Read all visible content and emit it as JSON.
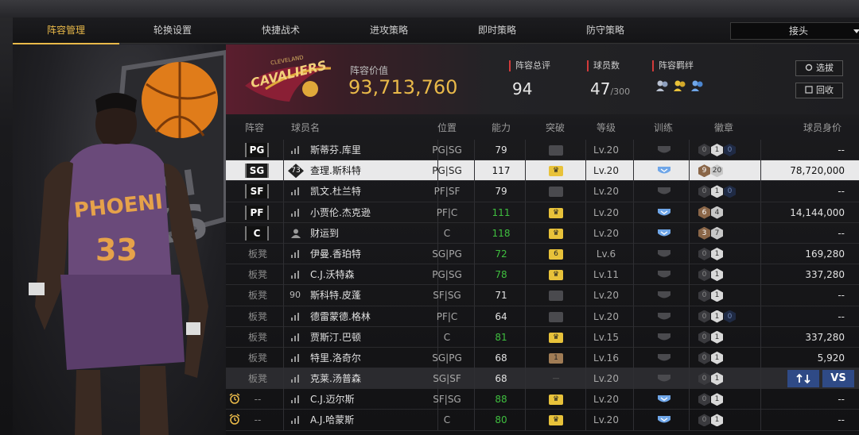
{
  "tabs": [
    {
      "label": "阵容管理",
      "active": true
    },
    {
      "label": "轮换设置",
      "active": false
    },
    {
      "label": "快捷战术",
      "active": false
    },
    {
      "label": "进攻策略",
      "active": false
    },
    {
      "label": "即时策略",
      "active": false
    },
    {
      "label": "防守策略",
      "active": false
    }
  ],
  "dropdown": {
    "value": "接头"
  },
  "team": {
    "logo_text": "CAVALIERS",
    "logo_sub": "CLEVELAND",
    "value_label": "阵容价值",
    "value": "93,713,760"
  },
  "stats": {
    "rating_label": "阵容总评",
    "rating": "94",
    "players_label": "球员数",
    "players": "47",
    "players_max": "/300",
    "bond_label": "阵容羁绊"
  },
  "buttons": {
    "select": "选拔",
    "recycle": "回收"
  },
  "columns": {
    "lineup": "阵容",
    "player": "球员名",
    "position": "位置",
    "ability": "能力",
    "breakthrough": "突破",
    "level": "等级",
    "training": "训练",
    "badges": "徽章",
    "worth": "球员身价"
  },
  "colors": {
    "accent": "#e9b949",
    "green": "#3fbf3f",
    "highlight_row": "#e9e9ea",
    "swap_button": "#2f4a86"
  },
  "swap": {
    "vs_label": "VS"
  },
  "players": [
    {
      "slot": "PG",
      "slot_type": "starter",
      "rank": "bars",
      "name": "斯蒂芬.库里",
      "pos": "PG|SG",
      "ability": "79",
      "green": false,
      "brk": "grey",
      "brk_text": "",
      "level": "Lv.20",
      "train": "grey",
      "badges": [
        [
          "b0",
          "0"
        ],
        [
          "b1",
          "1"
        ],
        [
          "bx",
          "0"
        ]
      ],
      "worth": "--"
    },
    {
      "slot": "SG",
      "slot_type": "starter",
      "rank": "73",
      "name": "查理.斯科特",
      "pos": "PG|SG",
      "ability": "117",
      "green": false,
      "brk": "gold",
      "brk_text": "",
      "level": "Lv.20",
      "train": "blue",
      "badges": [
        [
          "bro",
          "9"
        ],
        [
          "sil",
          "20"
        ]
      ],
      "worth": "78,720,000",
      "highlight": true
    },
    {
      "slot": "SF",
      "slot_type": "starter",
      "rank": "bars",
      "name": "凯文.杜兰特",
      "pos": "PF|SF",
      "ability": "79",
      "green": false,
      "brk": "grey",
      "brk_text": "",
      "level": "Lv.20",
      "train": "grey",
      "badges": [
        [
          "b0",
          "0"
        ],
        [
          "b1",
          "1"
        ],
        [
          "bx",
          "0"
        ]
      ],
      "worth": "--"
    },
    {
      "slot": "PF",
      "slot_type": "starter",
      "rank": "bars",
      "name": "小贾伦.杰克逊",
      "pos": "PF|C",
      "ability": "111",
      "green": true,
      "brk": "gold",
      "brk_text": "",
      "level": "Lv.20",
      "train": "blue",
      "badges": [
        [
          "bro",
          "6"
        ],
        [
          "sil",
          "4"
        ]
      ],
      "worth": "14,144,000"
    },
    {
      "slot": "C",
      "slot_type": "starter",
      "rank": "person",
      "name": "财运到",
      "pos": "C",
      "ability": "118",
      "green": true,
      "brk": "gold",
      "brk_text": "",
      "level": "Lv.20",
      "train": "blue",
      "badges": [
        [
          "bro",
          "3"
        ],
        [
          "sil",
          "7"
        ]
      ],
      "worth": "--"
    },
    {
      "slot": "板凳",
      "slot_type": "bench",
      "rank": "bars",
      "name": "伊曼.香珀特",
      "pos": "SG|PG",
      "ability": "72",
      "green": true,
      "brk": "gold",
      "brk_text": "6",
      "level": "Lv.6",
      "train": "grey",
      "badges": [
        [
          "b0",
          "0"
        ],
        [
          "b1",
          "1"
        ]
      ],
      "worth": "169,280"
    },
    {
      "slot": "板凳",
      "slot_type": "bench",
      "rank": "bars",
      "name": "C.J.沃特森",
      "pos": "PG|SG",
      "ability": "78",
      "green": true,
      "brk": "gold",
      "brk_text": "",
      "level": "Lv.11",
      "train": "grey",
      "badges": [
        [
          "b0",
          "0"
        ],
        [
          "b1",
          "1"
        ]
      ],
      "worth": "337,280"
    },
    {
      "slot": "板凳",
      "slot_type": "bench",
      "rank": "90",
      "name": "斯科特.皮蓬",
      "pos": "SF|SG",
      "ability": "71",
      "green": false,
      "brk": "grey",
      "brk_text": "",
      "level": "Lv.20",
      "train": "grey",
      "badges": [
        [
          "b0",
          "0"
        ],
        [
          "b1",
          "1"
        ]
      ],
      "worth": "--"
    },
    {
      "slot": "板凳",
      "slot_type": "bench",
      "rank": "bars",
      "name": "德雷蒙德.格林",
      "pos": "PF|C",
      "ability": "64",
      "green": false,
      "brk": "grey",
      "brk_text": "",
      "level": "Lv.20",
      "train": "grey",
      "badges": [
        [
          "b0",
          "0"
        ],
        [
          "b1",
          "1"
        ],
        [
          "bx",
          "0"
        ]
      ],
      "worth": "--"
    },
    {
      "slot": "板凳",
      "slot_type": "bench",
      "rank": "bars",
      "name": "贾斯汀.巴顿",
      "pos": "C",
      "ability": "81",
      "green": true,
      "brk": "gold",
      "brk_text": "",
      "level": "Lv.15",
      "train": "grey",
      "badges": [
        [
          "b0",
          "0"
        ],
        [
          "b1",
          "1"
        ]
      ],
      "worth": "337,280"
    },
    {
      "slot": "板凳",
      "slot_type": "bench",
      "rank": "bars",
      "name": "特里.洛奇尔",
      "pos": "SG|PG",
      "ability": "68",
      "green": false,
      "brk": "brown",
      "brk_text": "1",
      "level": "Lv.16",
      "train": "grey",
      "badges": [
        [
          "b0",
          "0"
        ],
        [
          "b1",
          "1"
        ]
      ],
      "worth": "5,920"
    },
    {
      "slot": "板凳",
      "slot_type": "bench",
      "rank": "bars",
      "name": "克莱.汤普森",
      "pos": "SG|SF",
      "ability": "68",
      "green": false,
      "brk": "grey",
      "brk_text": "",
      "level": "Lv.20",
      "train": "grey",
      "badges": [
        [
          "b0",
          "0"
        ],
        [
          "b1",
          "1"
        ]
      ],
      "worth": "",
      "selected": true
    },
    {
      "slot": "--",
      "slot_type": "reserve",
      "rank": "bars",
      "name": "C.J.迈尔斯",
      "pos": "SF|SG",
      "ability": "88",
      "green": true,
      "brk": "gold",
      "brk_text": "",
      "level": "Lv.20",
      "train": "blue",
      "badges": [
        [
          "b0",
          "0"
        ],
        [
          "b1",
          "1"
        ]
      ],
      "worth": "--"
    },
    {
      "slot": "--",
      "slot_type": "reserve",
      "rank": "bars",
      "name": "A.J.哈蒙斯",
      "pos": "C",
      "ability": "80",
      "green": true,
      "brk": "gold",
      "brk_text": "",
      "level": "Lv.20",
      "train": "blue",
      "badges": [
        [
          "b0",
          "0"
        ],
        [
          "b1",
          "1"
        ]
      ],
      "worth": "--"
    }
  ]
}
